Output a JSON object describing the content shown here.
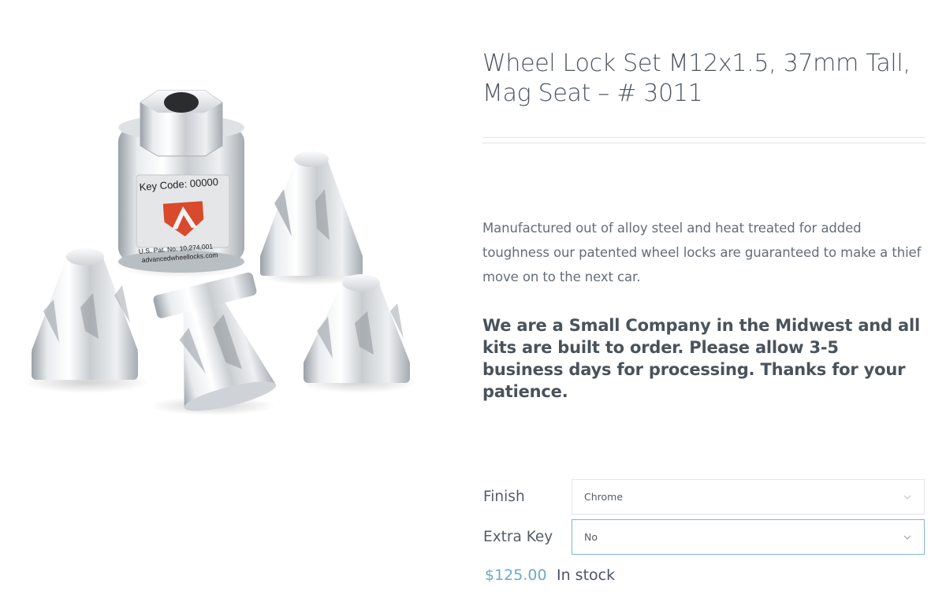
{
  "product": {
    "title_line1": "Wheel Lock Set M12x1.5, 37mm Tall,",
    "title_line2": "Mag Seat – # 3011",
    "description": "Manufactured out of alloy steel and heat treated for added toughness our patented wheel locks are guaranteed to make a thief move on to the next car.",
    "notice": "We are a Small Company in the Midwest and all kits are built to order.  Please allow 3-5 business days for processing. Thanks for your patience.",
    "image": {
      "key_label": "Key Code: 00000",
      "patent_text": "U.S. Pat. No. 10,274,001",
      "website_text": "advancedwheellocks.com"
    }
  },
  "options": {
    "finish": {
      "label": "Finish",
      "value": "Chrome"
    },
    "extra_key": {
      "label": "Extra Key",
      "value": "No"
    }
  },
  "purchase": {
    "price": "$125.00",
    "stock_status": "In stock"
  },
  "colors": {
    "price": "#6aa9c8",
    "logo_red": "#d9492c",
    "focus_border": "#7fb8cc"
  }
}
